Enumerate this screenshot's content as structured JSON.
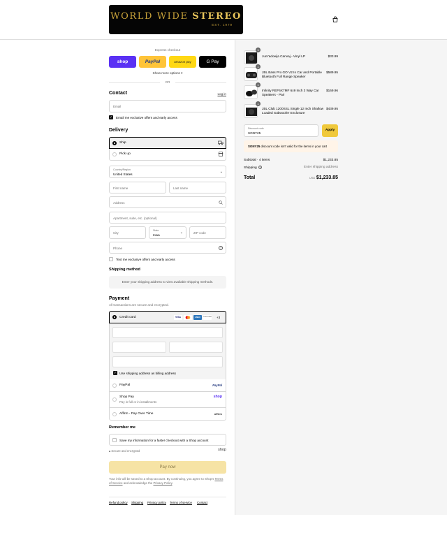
{
  "brand": {
    "name_light": "WORLD WIDE ",
    "name_bold": "STEREO",
    "tagline": "EST. 1979"
  },
  "colors": {
    "shop_pay": "#5a31f4",
    "paypal_yellow": "#ffc439",
    "amazon_yellow": "#ffd814",
    "gpay_black": "#000000",
    "apply_yellow": "#f0c93c",
    "pay_now_bg": "#f6e3a5",
    "notice_bg": "#fff4e8"
  },
  "express": {
    "title": "Express checkout",
    "buttons": [
      "shop",
      "PayPal",
      "amazon pay",
      "G Pay"
    ],
    "show_more": "Show more options",
    "or": "OR"
  },
  "contact": {
    "heading": "Contact",
    "login": "Log in",
    "email_placeholder": "Email",
    "offers": "Email me exclusive offers and early access"
  },
  "delivery": {
    "heading": "Delivery",
    "ship": "Ship",
    "pickup": "Pick up",
    "country_label": "Country/Region",
    "country_value": "United States",
    "first_name": "First name",
    "last_name": "Last name",
    "address": "Address",
    "apartment": "Apartment, suite, etc. (optional)",
    "city": "City",
    "state_label": "State",
    "state_value": "Iowa",
    "zip": "ZIP code",
    "phone": "Phone",
    "text_offers": "Text me exclusive offers and early access"
  },
  "shipping_method": {
    "heading": "Shipping method",
    "message": "Enter your shipping address to view available shipping methods."
  },
  "payment": {
    "heading": "Payment",
    "subtitle": "All transactions are secure and encrypted.",
    "credit_card": "Credit card",
    "card_brands": [
      "VISA",
      "MC",
      "AMEX",
      "DISCOVER"
    ],
    "more_cards": "+3",
    "billing_same": "Use shipping address as billing address",
    "paypal": "PayPal",
    "paypal_logo": "PayPal",
    "shoppay": "Shop Pay",
    "shoppay_sub": "Pay in full or in installments",
    "shoppay_logo": "shop",
    "affirm": "Affirm - Pay Over Time",
    "affirm_logo": "affirm"
  },
  "remember": {
    "heading": "Remember me",
    "save_info": "Save my information for a faster checkout with a Shop account",
    "secure": "Secure and encrypted",
    "shop_logo": "shop"
  },
  "pay_now": "Pay now",
  "legal": {
    "p1": "Your info will be saved to a Shop account. By continuing, you agree to Shop's ",
    "terms": "Terms of Service",
    "p2": " and acknowledge the ",
    "privacy": "Privacy Policy",
    "p3": "."
  },
  "footer_links": [
    "Refund policy",
    "Shipping",
    "Privacy policy",
    "Terms of service",
    "Contact"
  ],
  "cart": {
    "items": [
      {
        "qty": "1",
        "title": "Jum'adoeija Canvaj - Vinyl LP",
        "price": "$33.99"
      },
      {
        "qty": "1",
        "title": "JBL Bass Pro GO V2 In Car and Portable Bluetooth Full Range Speaker",
        "price": "$589.95"
      },
      {
        "qty": "1",
        "title": "Infinity REF6X7MF 6x9 Inch 3 Way Car Speakers - Pair",
        "price": "$169.96"
      },
      {
        "qty": "1",
        "title": "JBL Club 1200SSL Single 12 Inch Shallow Loaded Subwoofer Enclosure",
        "price": "$439.95"
      }
    ],
    "discount_label": "Discount code",
    "discount_value": "SONY25",
    "apply": "Apply",
    "notice_code": "SONY25",
    "notice_text": " discount code isn't valid for the items in your cart",
    "subtotal_label": "Subtotal · 4 items",
    "subtotal_value": "$1,233.85",
    "shipping_label": "Shipping",
    "shipping_value": "Enter shipping address",
    "total_label": "Total",
    "currency": "USD",
    "total_value": "$1,233.85"
  }
}
